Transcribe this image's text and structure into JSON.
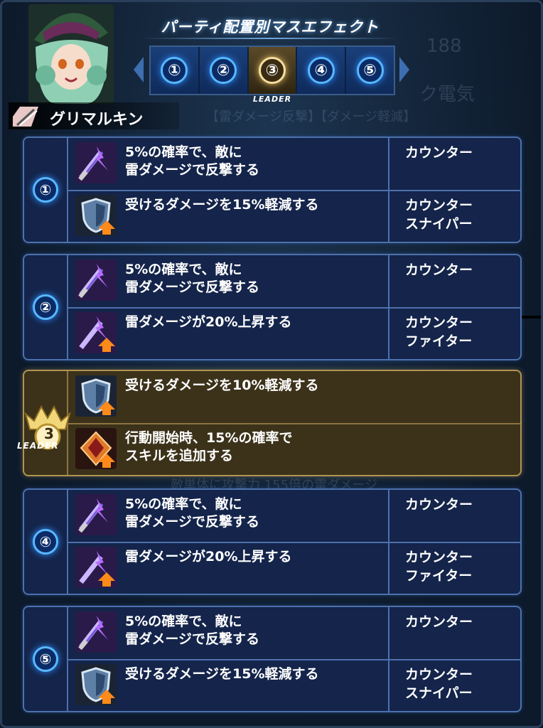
{
  "header": {
    "title": "パーティ配置別マスエフェクト",
    "tabs": [
      "①",
      "②",
      "③",
      "④",
      "⑤"
    ],
    "active_tab": 2,
    "leader_label": "LEADER"
  },
  "background": {
    "counter_value": "188",
    "text_a": "ク電気",
    "text_b": "【雷ダメージ反撃】【ダメージ軽減】",
    "text_c": "敵単体に攻撃力 155倍の雷ダメージ"
  },
  "unit": {
    "name": "グリマルキン"
  },
  "slots": [
    {
      "number": "①",
      "leader": false,
      "effects": [
        {
          "icon": "lightning-sword-icon",
          "text": "5%の確率で、敵に\n雷ダメージで反撃する",
          "type": "カウンター"
        },
        {
          "icon": "shield-up-icon",
          "text": "受けるダメージを15%軽減する",
          "type": "カウンター\nスナイパー"
        }
      ]
    },
    {
      "number": "②",
      "leader": false,
      "effects": [
        {
          "icon": "lightning-sword-icon",
          "text": "5%の確率で、敵に\n雷ダメージで反撃する",
          "type": "カウンター"
        },
        {
          "icon": "lightning-sword-up-icon",
          "text": "雷ダメージが20%上昇する",
          "type": "カウンター\nファイター"
        }
      ]
    },
    {
      "number": "3",
      "leader": true,
      "leader_label": "LEADER",
      "effects": [
        {
          "icon": "shield-up-icon",
          "text": "受けるダメージを10%軽減する",
          "type": ""
        },
        {
          "icon": "skill-gem-up-icon",
          "text": "行動開始時、15%の確率で\nスキルを追加する",
          "type": ""
        }
      ]
    },
    {
      "number": "④",
      "leader": false,
      "effects": [
        {
          "icon": "lightning-sword-icon",
          "text": "5%の確率で、敵に\n雷ダメージで反撃する",
          "type": "カウンター"
        },
        {
          "icon": "lightning-sword-up-icon",
          "text": "雷ダメージが20%上昇する",
          "type": "カウンター\nファイター"
        }
      ]
    },
    {
      "number": "⑤",
      "leader": false,
      "effects": [
        {
          "icon": "lightning-sword-icon",
          "text": "5%の確率で、敵に\n雷ダメージで反撃する",
          "type": "カウンター"
        },
        {
          "icon": "shield-up-icon",
          "text": "受けるダメージを15%軽減する",
          "type": "カウンター\nスナイパー"
        }
      ]
    }
  ],
  "colors": {
    "slot_border": "#4c71ae",
    "leader_border": "#b09452",
    "number_glow": "#58b8ff"
  }
}
